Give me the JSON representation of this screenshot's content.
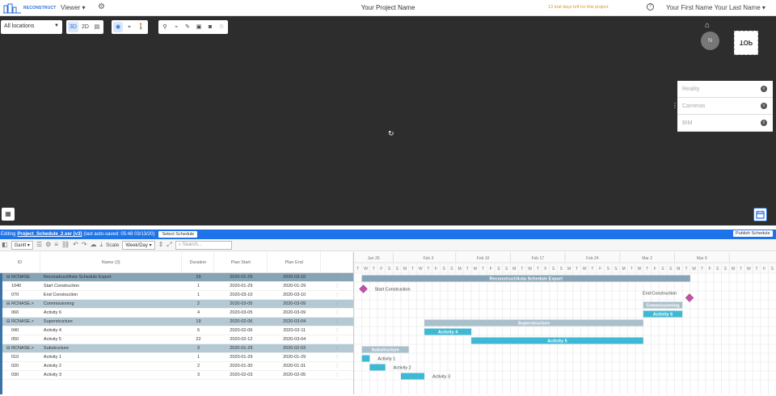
{
  "topbar": {
    "logo_text": "RECONSTRUCT",
    "viewer_label": "Viewer ▾",
    "project_name": "Your Project Name",
    "trial_text": "13 trial days left for this project",
    "user_name": "Your First Name Your Last Name ▾"
  },
  "viewer": {
    "location_select": "All locations",
    "mode_3d": "3D",
    "mode_2d": "2D",
    "side_panel": [
      {
        "label": "Reality"
      },
      {
        "label": "Cameras"
      },
      {
        "label": "BIM"
      }
    ],
    "view_cube_label": "TOP",
    "compass_label": "N"
  },
  "edit_bar": {
    "prefix": "Editing",
    "file": "Project_Schedule_2.xer [v3]",
    "autosave": "(last auto-saved: 05:48 03/13/20)",
    "select_schedule": "Select Schedule",
    "publish": "Publish Schedule"
  },
  "gantt_toolbar": {
    "view": "Gantt",
    "scale_label": "Scale",
    "scale_value": "Week/Day",
    "search_placeholder": "Search..."
  },
  "grid": {
    "headers": {
      "id": "ID",
      "name": "Name (3)",
      "duration": "Duration",
      "plan_start": "Plan Start",
      "plan_end": "Plan End"
    },
    "rows": [
      {
        "id": "RCNASE",
        "name": "Reconstruct/Asta Schedule Export",
        "duration": "29",
        "start": "2020-01-29",
        "end": "2020-03-10",
        "kind": "top"
      },
      {
        "id": "1040",
        "name": "Start Construction",
        "duration": "1",
        "start": "2020-01-29",
        "end": "2020-01-29",
        "kind": "task"
      },
      {
        "id": "070",
        "name": "End Construction",
        "duration": "1",
        "start": "2020-03-10",
        "end": "2020-03-10",
        "kind": "task"
      },
      {
        "id": "RCNASE.>",
        "name": "Commissioning",
        "duration": "2",
        "start": "2020-03-05",
        "end": "2020-03-09",
        "kind": "group"
      },
      {
        "id": "060",
        "name": "Activity 6",
        "duration": "4",
        "start": "2020-03-05",
        "end": "2020-03-09",
        "kind": "task"
      },
      {
        "id": "RCNASE.>",
        "name": "Superstructure",
        "duration": "19",
        "start": "2020-02-06",
        "end": "2020-03-04",
        "kind": "group"
      },
      {
        "id": "040",
        "name": "Activity 4",
        "duration": "6",
        "start": "2020-02-06",
        "end": "2020-02-11",
        "kind": "task"
      },
      {
        "id": "050",
        "name": "Activity 5",
        "duration": "22",
        "start": "2020-02-12",
        "end": "2020-03-04",
        "kind": "task"
      },
      {
        "id": "RCNASE.>",
        "name": "Substructure",
        "duration": "3",
        "start": "2020-01-29",
        "end": "2020-02-03",
        "kind": "group"
      },
      {
        "id": "010",
        "name": "Activity 1",
        "duration": "1",
        "start": "2020-01-29",
        "end": "2020-01-29",
        "kind": "task"
      },
      {
        "id": "020",
        "name": "Activity 2",
        "duration": "2",
        "start": "2020-01-30",
        "end": "2020-01-31",
        "kind": "task"
      },
      {
        "id": "030",
        "name": "Activity 3",
        "duration": "3",
        "start": "2020-02-03",
        "end": "2020-02-05",
        "kind": "task"
      }
    ]
  },
  "timeline": {
    "week_labels": [
      "Jan 26",
      "Feb 3",
      "Feb 10",
      "Feb 17",
      "Feb 24",
      "Mar 2",
      "Mar 9"
    ],
    "day_letters": [
      "T",
      "W",
      "T",
      "F",
      "S",
      "S",
      "M",
      "T",
      "W",
      "T",
      "F",
      "S",
      "S",
      "M",
      "T",
      "W",
      "T",
      "F",
      "S",
      "S",
      "M",
      "T",
      "W",
      "T",
      "F",
      "S",
      "S",
      "M",
      "T",
      "W",
      "T",
      "F",
      "S",
      "S",
      "M",
      "T",
      "W",
      "T",
      "F",
      "S",
      "S",
      "M",
      "T",
      "W",
      "T",
      "F",
      "S",
      "S",
      "M",
      "T",
      "W",
      "T",
      "F",
      "S"
    ],
    "bars": [
      {
        "row": 0,
        "label": "Reconstruct/Asta Schedule Export",
        "start": "2020-01-29",
        "end": "2020-03-10",
        "color": "#86a4b5"
      },
      {
        "row": 1,
        "label": "Start Construction",
        "start": "2020-01-29",
        "end": "2020-01-29",
        "milestone": true
      },
      {
        "row": 2,
        "label": "End Construction",
        "start": "2020-03-10",
        "end": "2020-03-10",
        "milestone": true
      },
      {
        "row": 3,
        "label": "Commissioning",
        "start": "2020-03-05",
        "end": "2020-03-09",
        "color": "#a9bfcc"
      },
      {
        "row": 4,
        "label": "Activity 6",
        "start": "2020-03-05",
        "end": "2020-03-09",
        "color": "#3fb8d4"
      },
      {
        "row": 5,
        "label": "Superstructure",
        "start": "2020-02-06",
        "end": "2020-03-04",
        "color": "#a9bfcc"
      },
      {
        "row": 6,
        "label": "Activity 4",
        "start": "2020-02-06",
        "end": "2020-02-11",
        "color": "#3fb8d4"
      },
      {
        "row": 7,
        "label": "Activity 5",
        "start": "2020-02-12",
        "end": "2020-03-04",
        "color": "#3fb8d4"
      },
      {
        "row": 8,
        "label": "Substructure",
        "start": "2020-01-29",
        "end": "2020-02-03",
        "color": "#a9bfcc"
      },
      {
        "row": 9,
        "label": "Activity 1",
        "start": "2020-01-29",
        "end": "2020-01-29",
        "color": "#3fb8d4",
        "label_outside": true
      },
      {
        "row": 10,
        "label": "Activity 2",
        "start": "2020-01-30",
        "end": "2020-01-31",
        "color": "#3fb8d4",
        "label_outside": true
      },
      {
        "row": 11,
        "label": "Activity 3",
        "start": "2020-02-03",
        "end": "2020-02-05",
        "color": "#3fb8d4",
        "label_outside": true
      }
    ],
    "milestone_color": "#c64fa6"
  }
}
